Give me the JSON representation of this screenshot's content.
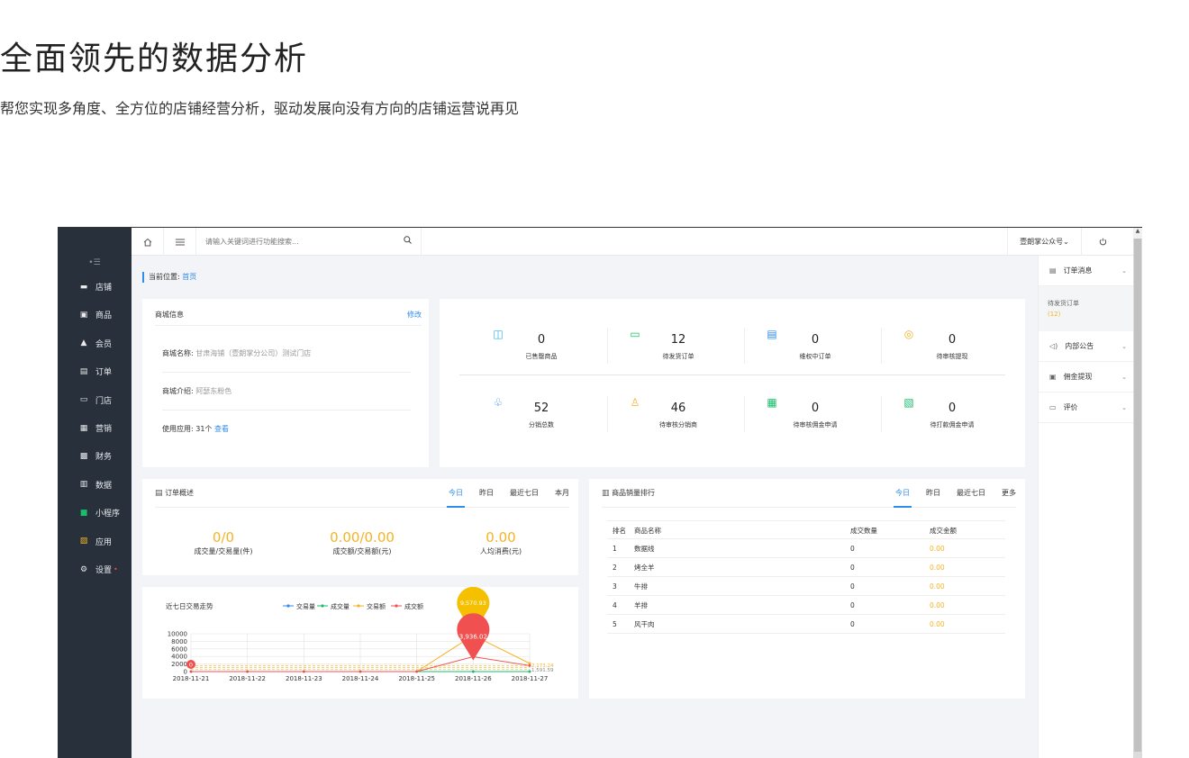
{
  "hero": {
    "title": "全面领先的数据分析",
    "subtitle": "帮您实现多角度、全方位的店铺经营分析，驱动发展向没有方向的店铺运营说再见"
  },
  "sidebar": {
    "collapse_label": "•☰",
    "items": [
      {
        "label": "店铺",
        "icon": "store-icon"
      },
      {
        "label": "商品",
        "icon": "goods-icon"
      },
      {
        "label": "会员",
        "icon": "member-icon"
      },
      {
        "label": "订单",
        "icon": "order-icon"
      },
      {
        "label": "门店",
        "icon": "shop-icon"
      },
      {
        "label": "营销",
        "icon": "gift-icon"
      },
      {
        "label": "财务",
        "icon": "finance-icon"
      },
      {
        "label": "数据",
        "icon": "data-icon"
      },
      {
        "label": "小程序",
        "icon": "miniprogram-icon"
      },
      {
        "label": "应用",
        "icon": "apps-icon"
      },
      {
        "label": "设置",
        "icon": "settings-icon",
        "badge": "•"
      }
    ]
  },
  "topbar": {
    "search_placeholder": "请输入关键词进行功能搜索...",
    "account": "壹朗掌公众号⌄"
  },
  "breadcrumb": {
    "prefix": "当前位置:",
    "home": "首页"
  },
  "store": {
    "title": "商城信息",
    "edit": "修改",
    "name_label": "商城名称:",
    "name_value": "甘肃海铺（壹朗掌分公司）测试门店",
    "intro_label": "商城介绍:",
    "intro_value": "阿瑟东粉色",
    "apps_label": "使用应用: 31个",
    "apps_link": "查看"
  },
  "stats": [
    {
      "value": "0",
      "label": "已售罄商品",
      "icon": "bag-icon"
    },
    {
      "value": "12",
      "label": "待发货订单",
      "icon": "truck-icon"
    },
    {
      "value": "0",
      "label": "维权中订单",
      "icon": "document-icon"
    },
    {
      "value": "0",
      "label": "待审核提现",
      "icon": "audit-icon"
    },
    {
      "value": "52",
      "label": "分销总数",
      "icon": "users-icon"
    },
    {
      "value": "46",
      "label": "待审核分销商",
      "icon": "user-icon"
    },
    {
      "value": "0",
      "label": "待审核佣金申请",
      "icon": "commission-icon"
    },
    {
      "value": "0",
      "label": "待打款佣金申请",
      "icon": "payment-icon"
    }
  ],
  "orders": {
    "title": "订单概述",
    "tabs": [
      "今日",
      "昨日",
      "最近七日",
      "本月"
    ],
    "items": [
      {
        "value": "0/0",
        "label": "成交量/交易量(件)"
      },
      {
        "value": "0.00/0.00",
        "label": "成交额/交易额(元)"
      },
      {
        "value": "0.00",
        "label": "人均消费(元)"
      }
    ]
  },
  "trend": {
    "title": "近七日交易走势",
    "legend": [
      "交易量",
      "成交量",
      "交易额",
      "成交额"
    ],
    "peak_yellow": "9,570.93",
    "peak_red": "3,936.02",
    "start_marker": "0",
    "end_yellow": "2,173.24",
    "end_red": "1,591.59"
  },
  "ranking": {
    "title": "商品销量排行",
    "tabs": [
      "今日",
      "昨日",
      "最近七日",
      "更多"
    ],
    "columns": [
      "排名",
      "商品名称",
      "成交数量",
      "成交金额"
    ],
    "rows": [
      {
        "rank": "1",
        "name": "数据线",
        "qty": "0",
        "amount": "0.00"
      },
      {
        "rank": "2",
        "name": "烤全羊",
        "qty": "0",
        "amount": "0.00"
      },
      {
        "rank": "3",
        "name": "牛排",
        "qty": "0",
        "amount": "0.00"
      },
      {
        "rank": "4",
        "name": "羊排",
        "qty": "0",
        "amount": "0.00"
      },
      {
        "rank": "5",
        "name": "风干肉",
        "qty": "0",
        "amount": "0.00"
      }
    ]
  },
  "rightpanel": {
    "order_msg": "订单消息",
    "pending_label": "待发货订单",
    "pending_count": "(12)",
    "notice": "内部公告",
    "commission": "佣金提现",
    "review": "评价"
  },
  "chart_data": {
    "type": "line",
    "title": "近七日交易走势",
    "categories": [
      "2018-11-21",
      "2018-11-22",
      "2018-11-23",
      "2018-11-24",
      "2018-11-25",
      "2018-11-26",
      "2018-11-27"
    ],
    "yticks": [
      "10000",
      "8000",
      "6000",
      "4000",
      "2000",
      "0"
    ],
    "ylim": [
      0,
      10000
    ],
    "series": [
      {
        "name": "交易量",
        "color": "#2e8ded",
        "values": [
          0,
          0,
          0,
          0,
          0,
          0,
          0
        ]
      },
      {
        "name": "成交量",
        "color": "#19be6b",
        "values": [
          0,
          0,
          0,
          0,
          0,
          0,
          0
        ]
      },
      {
        "name": "交易额",
        "color": "#f5b324",
        "values": [
          0,
          0,
          0,
          0,
          0,
          9570.93,
          2173.24
        ]
      },
      {
        "name": "成交额",
        "color": "#f05050",
        "values": [
          0,
          0,
          0,
          0,
          0,
          3936.02,
          1591.59
        ]
      }
    ],
    "legend": "top"
  }
}
